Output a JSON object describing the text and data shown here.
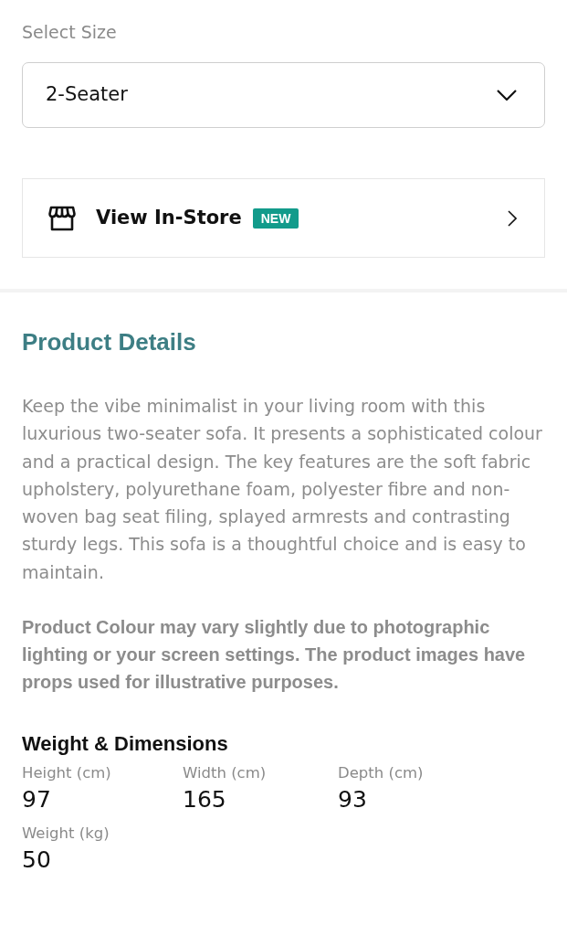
{
  "size_selector": {
    "label": "Select Size",
    "value": "2-Seater"
  },
  "in_store": {
    "label": "View In-Store",
    "badge": "NEW"
  },
  "product_details": {
    "title": "Product Details",
    "description": "Keep the vibe minimalist in your living room with this luxurious two-seater sofa. It presents a sophisticated colour and a practical design. The key features are the soft fabric upholstery, polyurethane foam, polyester fibre and non-woven bag seat filing, splayed armrests and contrasting sturdy legs. This sofa is a thoughtful choice and is easy to maintain.",
    "disclaimer": "Product Colour may vary slightly due to photographic lighting or your screen settings. The product images have props used for illustrative purposes."
  },
  "weight_dimensions": {
    "title": "Weight & Dimensions",
    "specs": [
      {
        "label": "Height (cm)",
        "value": "97"
      },
      {
        "label": "Width (cm)",
        "value": "165"
      },
      {
        "label": "Depth (cm)",
        "value": "93"
      },
      {
        "label": "Weight (kg)",
        "value": "50"
      }
    ]
  }
}
